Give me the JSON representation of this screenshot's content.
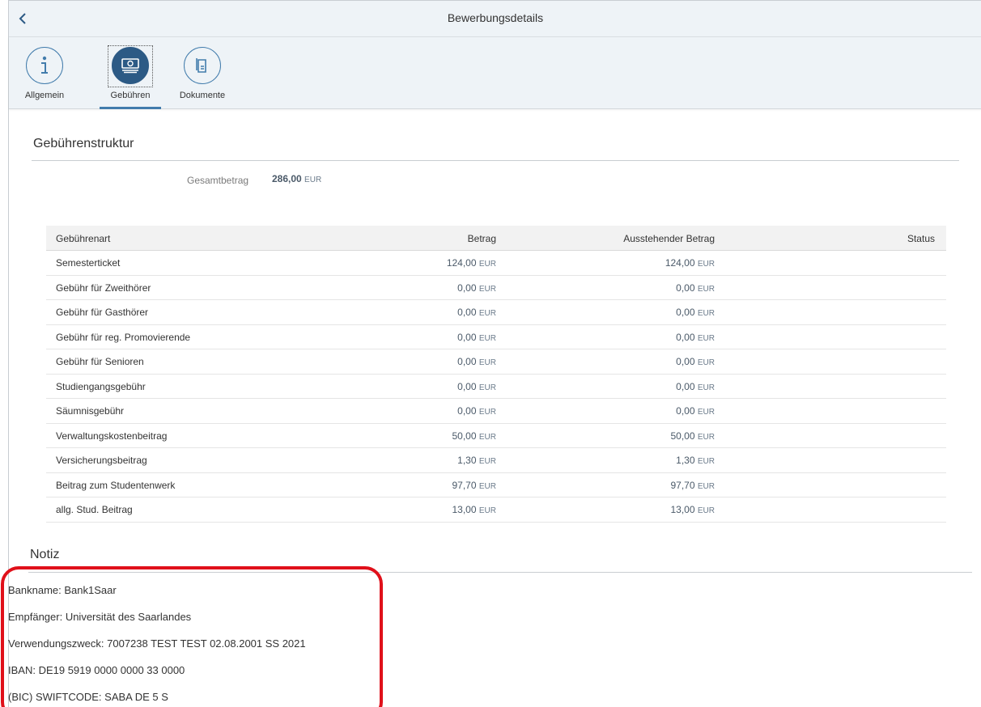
{
  "header": {
    "title": "Bewerbungsdetails"
  },
  "tabs": [
    {
      "label": "Allgemein"
    },
    {
      "label": "Gebühren"
    },
    {
      "label": "Dokumente"
    }
  ],
  "fees": {
    "section_title": "Gebührenstruktur",
    "total_label": "Gesamtbetrag",
    "total_value": "286,00",
    "currency": "EUR",
    "columns": [
      "Gebührenart",
      "Betrag",
      "Ausstehender Betrag",
      "Status"
    ],
    "rows": [
      {
        "art": "Semesterticket",
        "betrag": "124,00",
        "aus": "124,00",
        "status": ""
      },
      {
        "art": "Gebühr für Zweithörer",
        "betrag": "0,00",
        "aus": "0,00",
        "status": ""
      },
      {
        "art": "Gebühr für Gasthörer",
        "betrag": "0,00",
        "aus": "0,00",
        "status": ""
      },
      {
        "art": "Gebühr für reg. Promovierende",
        "betrag": "0,00",
        "aus": "0,00",
        "status": ""
      },
      {
        "art": "Gebühr für Senioren",
        "betrag": "0,00",
        "aus": "0,00",
        "status": ""
      },
      {
        "art": "Studiengangsgebühr",
        "betrag": "0,00",
        "aus": "0,00",
        "status": ""
      },
      {
        "art": "Säumnisgebühr",
        "betrag": "0,00",
        "aus": "0,00",
        "status": ""
      },
      {
        "art": "Verwaltungskostenbeitrag",
        "betrag": "50,00",
        "aus": "50,00",
        "status": ""
      },
      {
        "art": "Versicherungsbeitrag",
        "betrag": "1,30",
        "aus": "1,30",
        "status": ""
      },
      {
        "art": "Beitrag zum Studentenwerk",
        "betrag": "97,70",
        "aus": "97,70",
        "status": ""
      },
      {
        "art": "allg. Stud. Beitrag",
        "betrag": "13,00",
        "aus": "13,00",
        "status": ""
      }
    ]
  },
  "note": {
    "section_title": "Notiz",
    "lines": [
      "Bankname: Bank1Saar",
      "Empfänger: Universität des Saarlandes",
      "Verwendungszweck: 7007238 TEST TEST 02.08.2001 SS 2021",
      "IBAN: DE19 5919 0000 0000 33 0000",
      "(BIC) SWIFTCODE: SABA DE 5 S"
    ]
  },
  "colors": {
    "accent": "#427cac",
    "highlight": "#e0101a",
    "header_bg": "#eef3f7"
  },
  "icons": {
    "back": "chevron-left-icon",
    "tab1": "info-icon",
    "tab2": "money-icon",
    "tab3": "document-icon"
  }
}
